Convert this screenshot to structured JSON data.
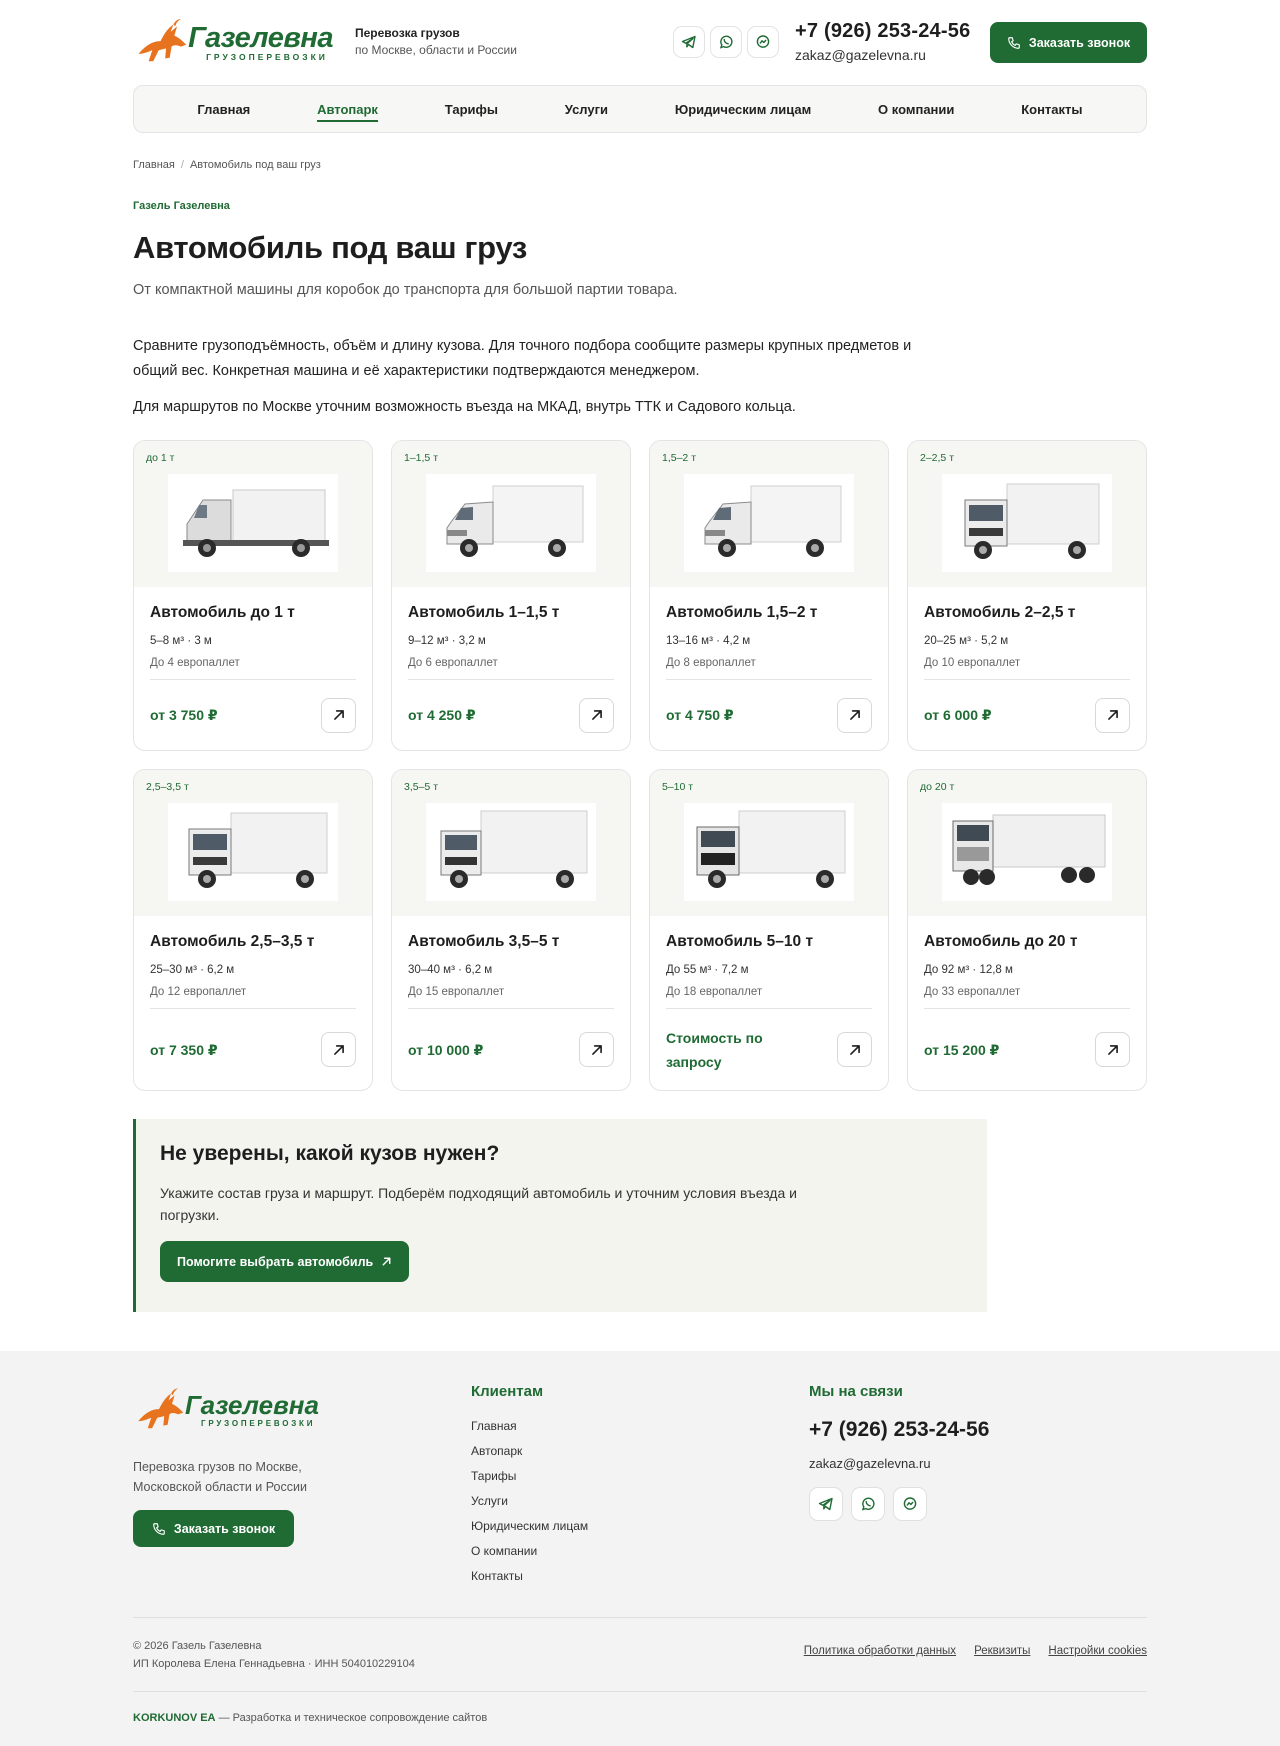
{
  "header": {
    "brand": "Газелевна",
    "brand_sub": "ГРУЗОПЕРЕВОЗКИ",
    "tagline_1": "Перевозка грузов",
    "tagline_2": "по Москве, области и России",
    "phone": "+7 (926) 253-24-56",
    "email": "zakaz@gazelevna.ru",
    "call_button": "Заказать звонок",
    "socials": [
      "telegram-icon",
      "whatsapp-icon",
      "max-messenger-icon"
    ]
  },
  "nav": {
    "items": [
      "Главная",
      "Автопарк",
      "Тарифы",
      "Услуги",
      "Юридическим лицам",
      "О компании",
      "Контакты"
    ],
    "active": "Автопарк"
  },
  "breadcrumb": {
    "home": "Главная",
    "separator": "/",
    "current": "Автомобиль под ваш груз"
  },
  "page": {
    "eyebrow": "Газель Газелевна",
    "title": "Автомобиль под ваш груз",
    "lead": "От компактной машины для коробок до транспорта для большой партии товара.",
    "para_1": "Сравните грузоподъёмность, объём и длину кузова. Для точного подбора сообщите размеры крупных предметов и общий вес. Конкретная машина и её характеристики подтверждаются менеджером.",
    "para_2": "Для маршрутов по Москве уточним возможность въезда на МКАД, внутрь ТТК и Садового кольца."
  },
  "cards": [
    {
      "cap": "до 1 т",
      "title": "Автомобиль до 1 т",
      "spec": "5–8 м³ · 3 м",
      "pallets": "До 4 европаллет",
      "price": "от 3 750 ₽"
    },
    {
      "cap": "1–1,5 т",
      "title": "Автомобиль 1–1,5 т",
      "spec": "9–12 м³ · 3,2 м",
      "pallets": "До 6 европаллет",
      "price": "от 4 250 ₽"
    },
    {
      "cap": "1,5–2 т",
      "title": "Автомобиль 1,5–2 т",
      "spec": "13–16 м³ · 4,2 м",
      "pallets": "До 8 европаллет",
      "price": "от 4 750 ₽"
    },
    {
      "cap": "2–2,5 т",
      "title": "Автомобиль 2–2,5 т",
      "spec": "20–25 м³ · 5,2 м",
      "pallets": "До 10 европаллет",
      "price": "от 6 000 ₽"
    },
    {
      "cap": "2,5–3,5 т",
      "title": "Автомобиль 2,5–3,5 т",
      "spec": "25–30 м³ · 6,2 м",
      "pallets": "До 12 европаллет",
      "price": "от 7 350 ₽"
    },
    {
      "cap": "3,5–5 т",
      "title": "Автомобиль 3,5–5 т",
      "spec": "30–40 м³ · 6,2 м",
      "pallets": "До 15 европаллет",
      "price": "от 10 000 ₽"
    },
    {
      "cap": "5–10 т",
      "title": "Автомобиль 5–10 т",
      "spec": "До 55 м³ · 7,2 м",
      "pallets": "До 18 европаллет",
      "price": "Стоимость по запросу"
    },
    {
      "cap": "до 20 т",
      "title": "Автомобиль до 20 т",
      "spec": "До 92 м³ · 12,8 м",
      "pallets": "До 33 европаллет",
      "price": "от 15 200 ₽"
    }
  ],
  "help": {
    "title": "Не уверены, какой кузов нужен?",
    "text": "Укажите состав груза и маршрут. Подберём подходящий автомобиль и уточним условия въезда и погрузки.",
    "button": "Помогите выбрать автомобиль"
  },
  "footer": {
    "desc": "Перевозка грузов по Москве, Московской области и России",
    "call_button": "Заказать звонок",
    "clients_title": "Клиентам",
    "links": [
      "Главная",
      "Автопарк",
      "Тарифы",
      "Услуги",
      "Юридическим лицам",
      "О компании",
      "Контакты"
    ],
    "contact_title": "Мы на связи",
    "phone": "+7 (926) 253-24-56",
    "email": "zakaz@gazelevna.ru",
    "copyright": "© 2026 Газель Газелевна",
    "entity": "ИП Королева Елена Геннадьевна · ИНН 504010229104",
    "legal": [
      "Политика обработки данных",
      "Реквизиты",
      "Настройки cookies"
    ],
    "dev_name": "KORKUNOV EA",
    "dev_text": " — Разработка и техническое сопровождение сайтов"
  },
  "colors": {
    "brand_green": "#1f6b33",
    "brand_orange": "#e8731e"
  }
}
